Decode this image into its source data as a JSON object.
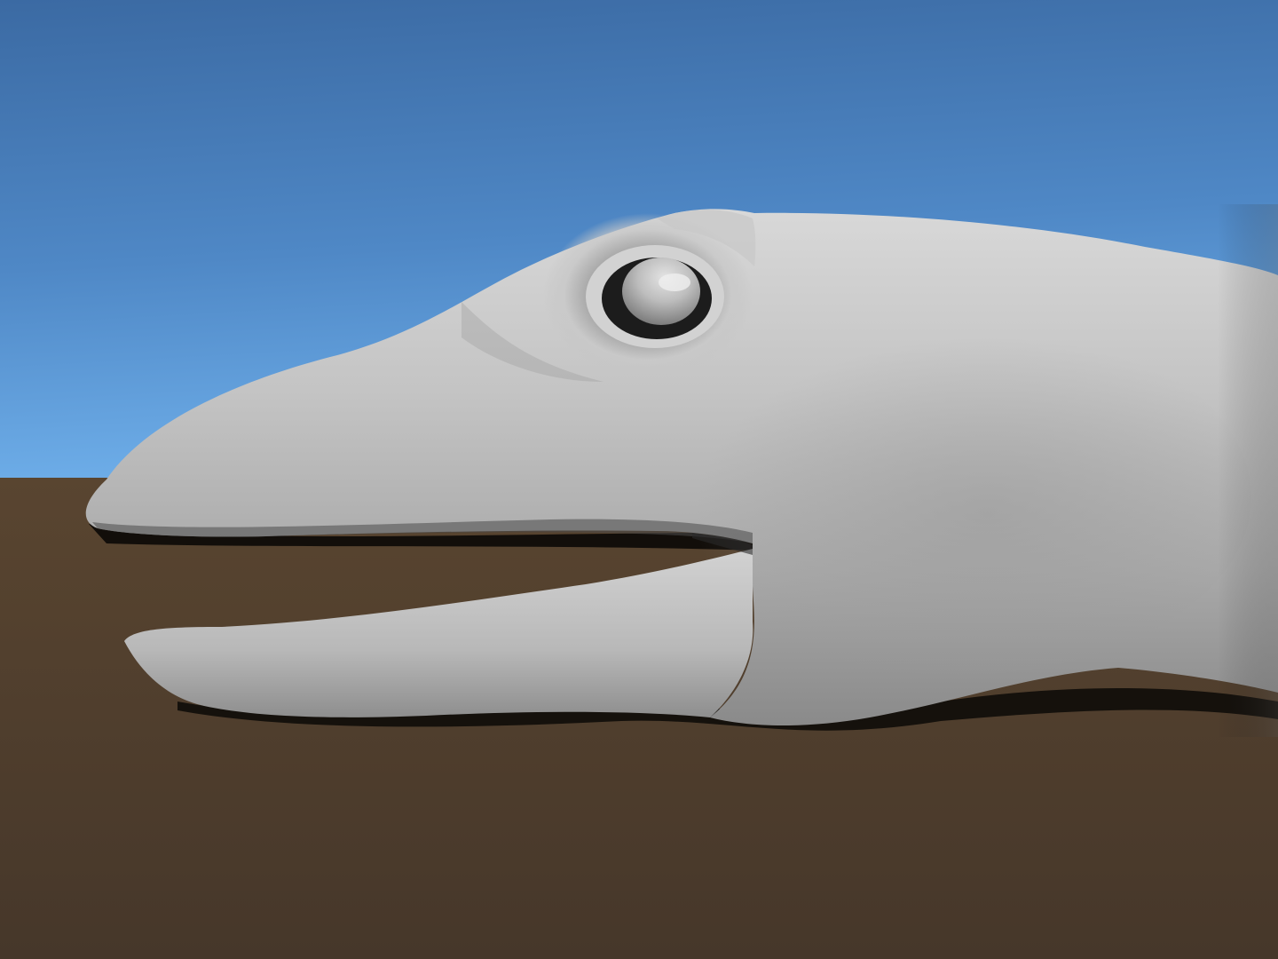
{
  "scene": {
    "subject": "grey-untextured-3d-reptile-head-model",
    "colors": {
      "sky_top": "#3f6ea6",
      "sky_bottom": "#6aaae6",
      "ground_top": "#5a4631",
      "ground_bottom": "#4a3a2a",
      "model_light": "#d6d6d6",
      "model_mid": "#b4b4b4",
      "model_dark": "#7a7a7a",
      "shadow": "#0a0806"
    }
  }
}
